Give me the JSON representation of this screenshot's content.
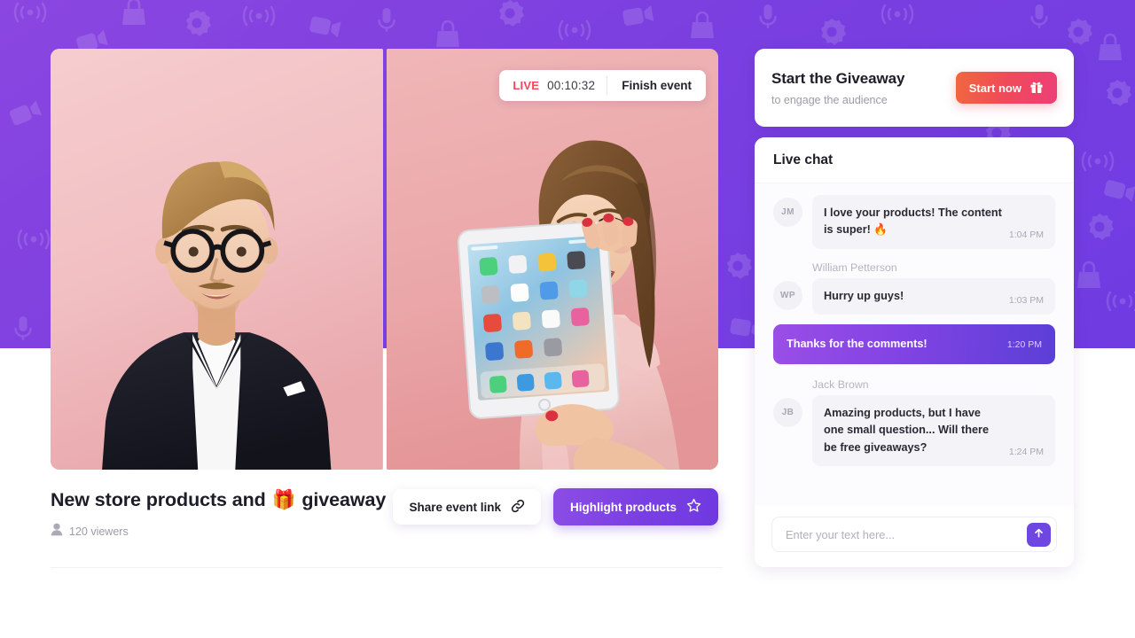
{
  "stream": {
    "live_badge": "LIVE",
    "timer": "00:10:32",
    "finish_label": "Finish event",
    "tiles": [
      {
        "name": "presenter-male",
        "background": "#f3c3c6"
      },
      {
        "name": "presenter-female",
        "background": "#efaeb0"
      }
    ]
  },
  "event": {
    "title_before": "New store products and",
    "title_emoji": "🎁",
    "title_after": "giveaway",
    "viewers": "120 viewers",
    "share_label": "Share event link",
    "highlight_label": "Highlight products"
  },
  "giveaway": {
    "title": "Start the Giveaway",
    "subtitle": "to engage the audience",
    "button_label": "Start now"
  },
  "chat": {
    "header": "Live chat",
    "messages": [
      {
        "initials": "JM",
        "sender": "",
        "text": "I love your products! The content is super! 🔥",
        "time": "1:04 PM",
        "outgoing": false
      },
      {
        "initials": "WP",
        "sender": "William Petterson",
        "text": "Hurry up guys!",
        "time": "1:03 PM",
        "outgoing": false
      },
      {
        "initials": "",
        "sender": "",
        "text": "Thanks for the comments!",
        "time": "1:20 PM",
        "outgoing": true
      },
      {
        "initials": "JB",
        "sender": "Jack Brown",
        "text": "Amazing products, but I have one small question... Will there be free giveaways?",
        "time": "1:24 PM",
        "outgoing": false
      }
    ],
    "composer_placeholder": "Enter your text here..."
  },
  "colors": {
    "banner_purple": "#7b3fe0",
    "accent_purple": "#6f47e0",
    "live_red": "#f5455c",
    "start_gradient_from": "#f1683f",
    "start_gradient_to": "#ed3f77"
  }
}
